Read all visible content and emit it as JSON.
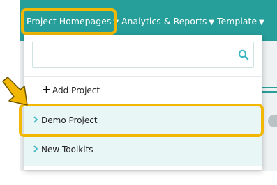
{
  "nav": {
    "items": [
      {
        "label": "Project Homepages"
      },
      {
        "label": "Analytics & Reports"
      },
      {
        "label": "Template"
      }
    ],
    "caret": "▼"
  },
  "dropdown": {
    "search": {
      "placeholder": "",
      "value": "",
      "icon": "search-icon"
    },
    "add_project": {
      "icon": "plus-icon",
      "label": "Add Project"
    },
    "projects": [
      {
        "label": "Demo Project",
        "icon": "chevron-right-icon"
      },
      {
        "label": "New Toolkits",
        "icon": "chevron-right-icon"
      }
    ]
  },
  "colors": {
    "navbar": "#269e9a",
    "highlight": "#f2b705",
    "row_bg": "#e8f6f5",
    "chevron": "#3cb6c2"
  }
}
